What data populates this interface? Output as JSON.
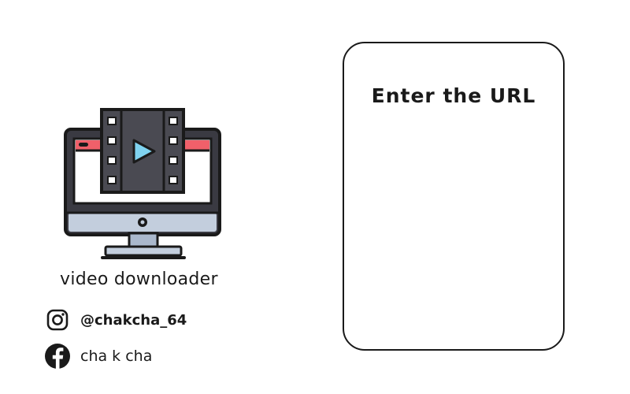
{
  "app": {
    "name": "video downloader",
    "logo_icon": "monitor-film-play-icon"
  },
  "social": {
    "instagram": {
      "icon": "instagram-icon",
      "handle": "@chakcha_64"
    },
    "facebook": {
      "icon": "facebook-icon",
      "name": "cha k cha"
    }
  },
  "url_panel": {
    "title": "Enter the URL"
  },
  "colors": {
    "outline": "#1a1a1a",
    "screen_bar": "#f0606a",
    "film": "#4a4a52",
    "play": "#7fd3f0",
    "stand": "#aab8cc",
    "monitor_body": "#3a3a42"
  }
}
